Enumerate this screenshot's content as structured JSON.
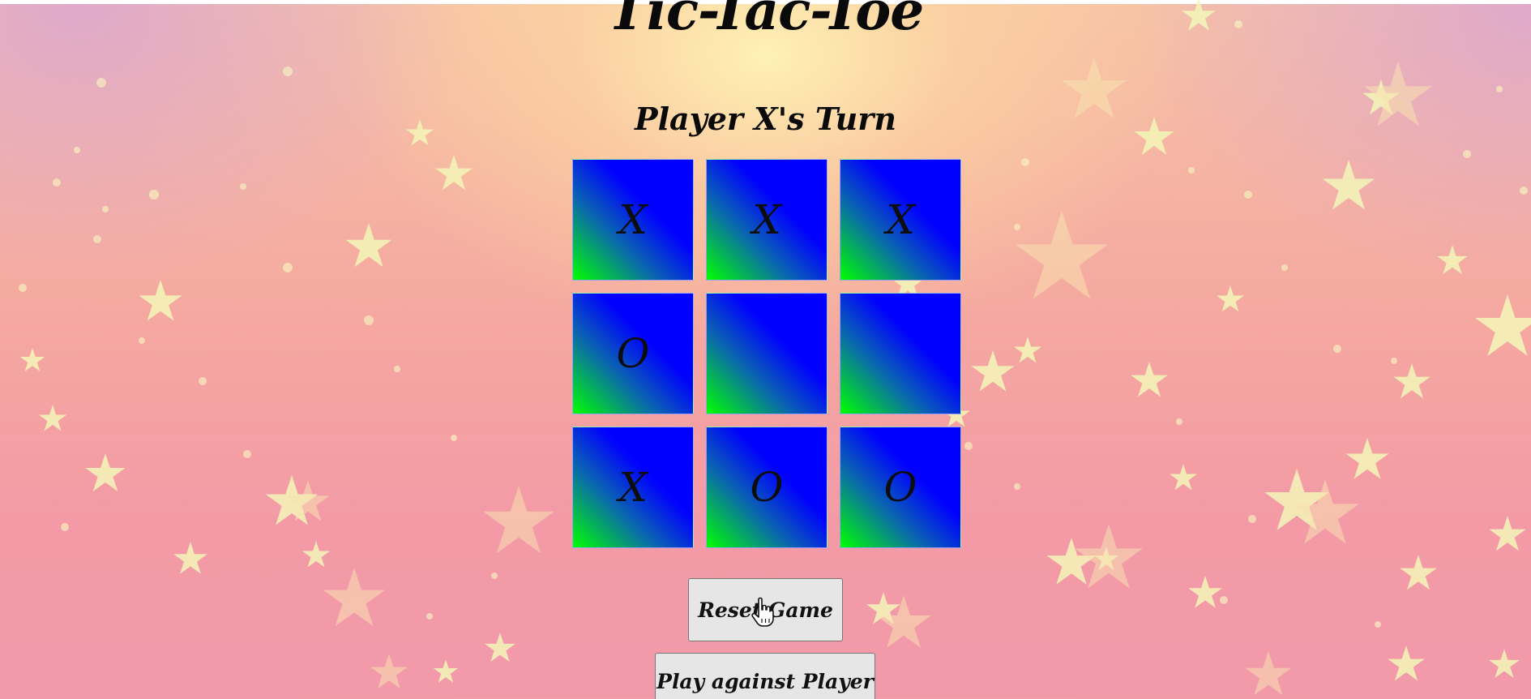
{
  "page": {
    "title": "Tic-Tac-Toe",
    "status": "Player X's Turn"
  },
  "board": {
    "cells": [
      "X",
      "X",
      "X",
      "O",
      "",
      "",
      "X",
      "O",
      "O"
    ]
  },
  "buttons": {
    "reset_label": "Reset Game",
    "play_label": "Play against Player"
  },
  "colors": {
    "cell_gradient_start": "#00ff00",
    "cell_gradient_end": "#0000ff",
    "button_bg": "#e6e6e6",
    "text": "#0a0a0a"
  },
  "icons": {
    "cursor": "hand-pointer-icon",
    "background": "star-icon"
  }
}
